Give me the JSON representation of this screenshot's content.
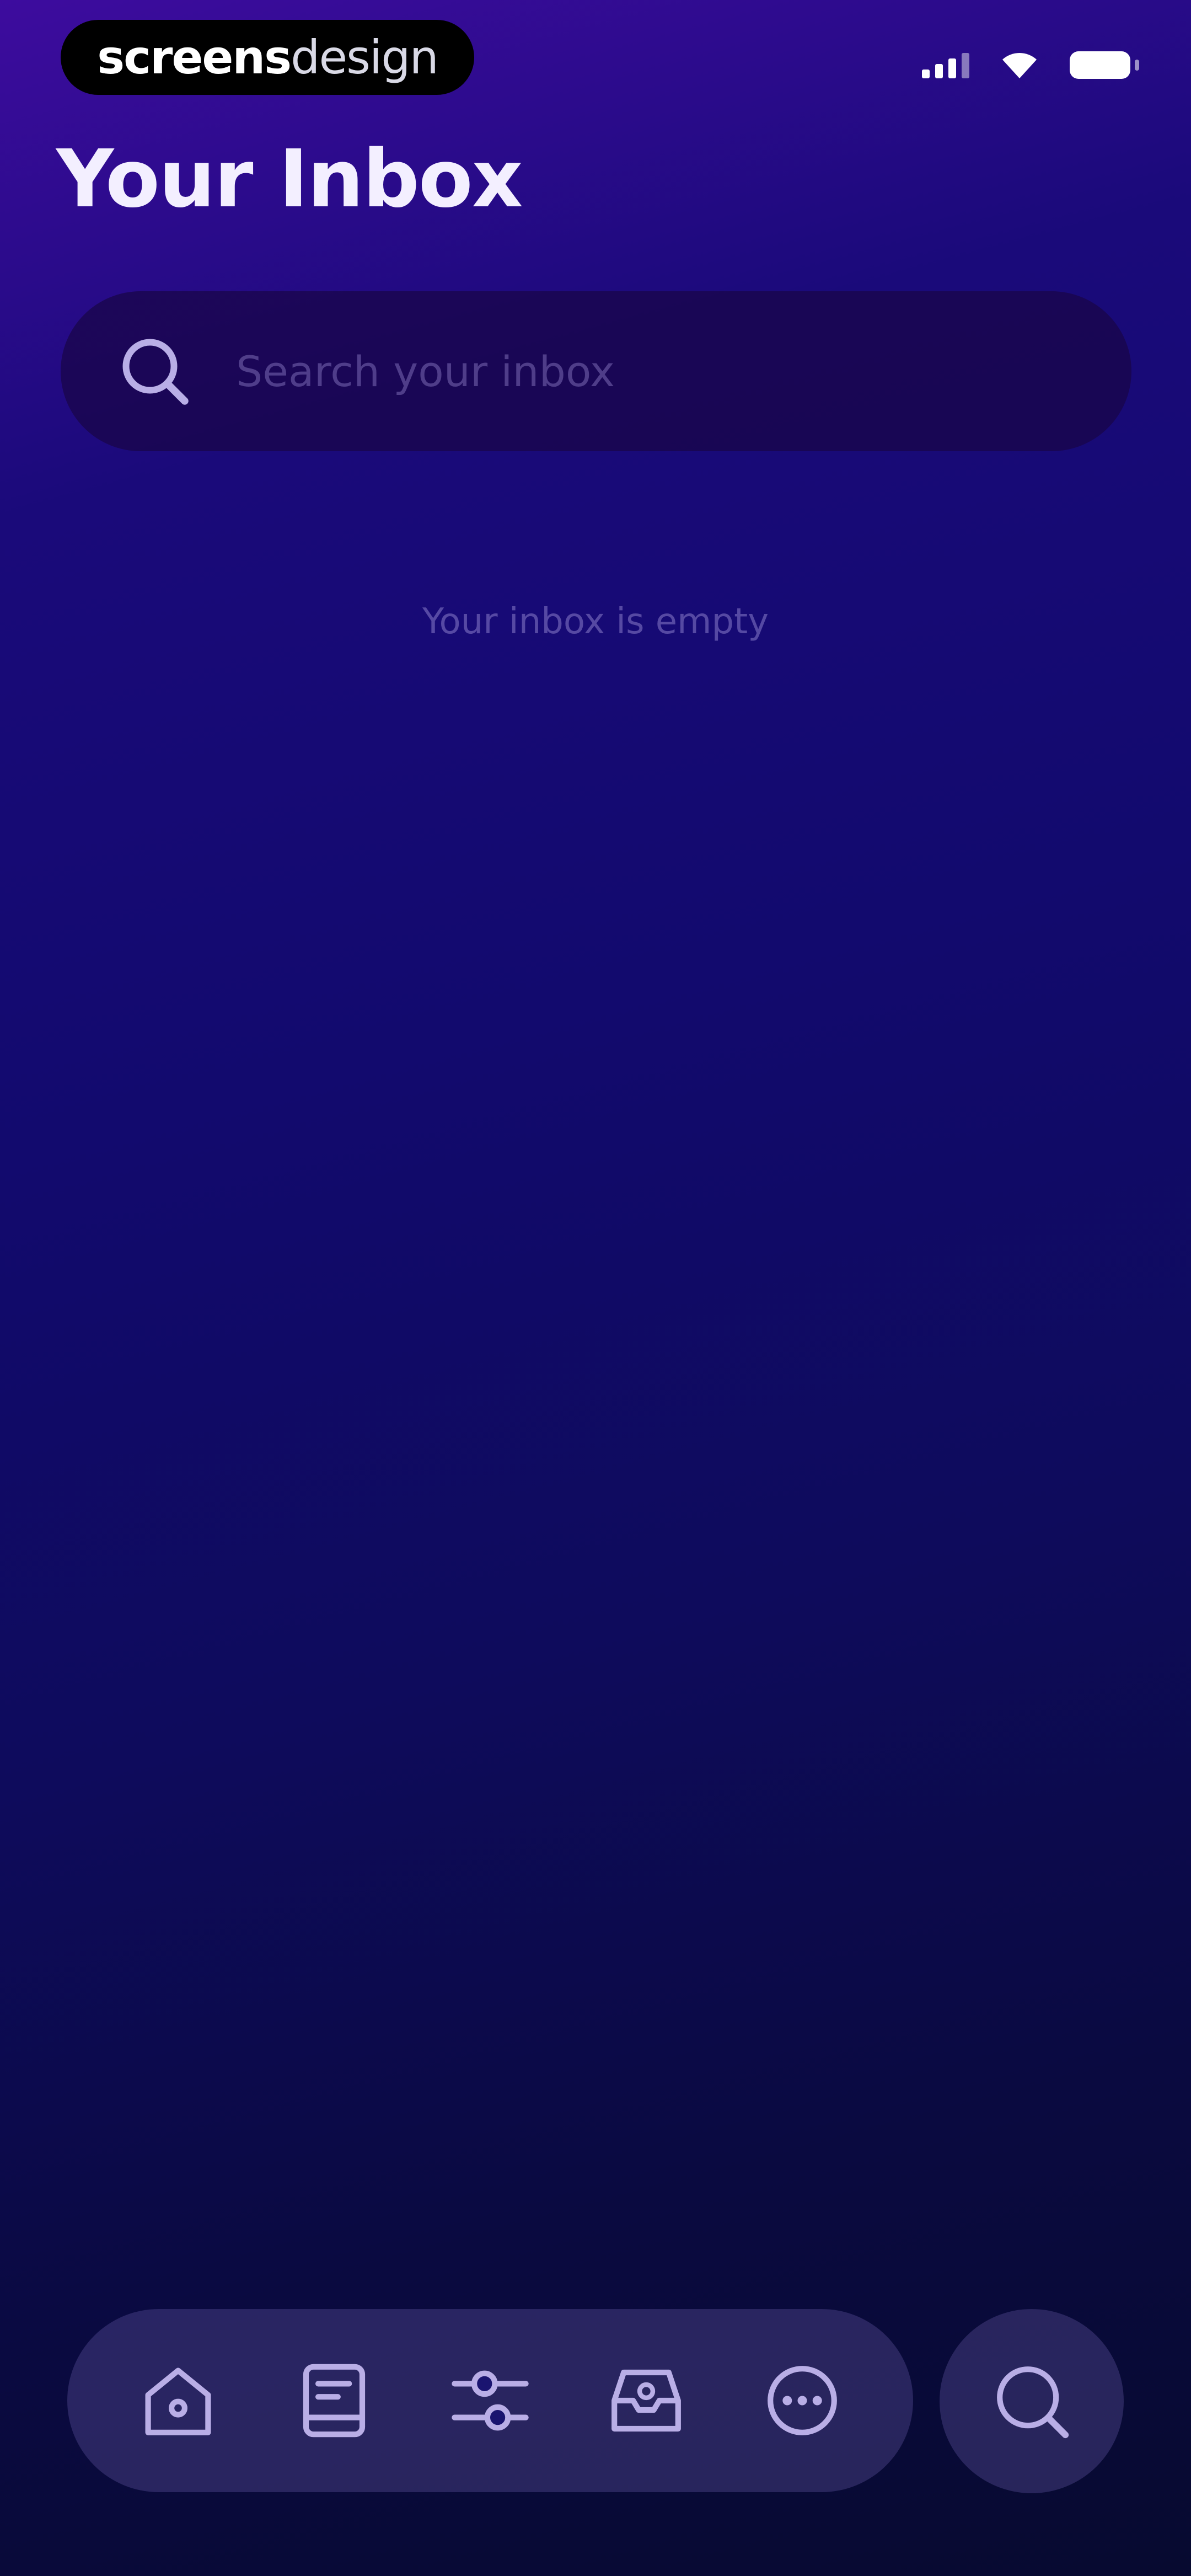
{
  "status_bar": {
    "brand_bold": "screens",
    "brand_light": "design",
    "icons": [
      "cellular-signal-icon",
      "wifi-icon",
      "battery-icon"
    ]
  },
  "header": {
    "title": "Your Inbox"
  },
  "search": {
    "placeholder": "Search your inbox",
    "value": ""
  },
  "empty_state": {
    "message": "Your inbox is empty"
  },
  "tab_bar": {
    "items": [
      {
        "icon": "home-icon"
      },
      {
        "icon": "notes-icon"
      },
      {
        "icon": "sliders-icon"
      },
      {
        "icon": "inbox-icon"
      },
      {
        "icon": "more-icon"
      }
    ],
    "search_button_icon": "search-icon"
  },
  "colors": {
    "background_top": "#3d0c9e",
    "background_bottom": "#070a30",
    "icon_tint": "#b9aee6",
    "text_primary": "#f3efff"
  }
}
